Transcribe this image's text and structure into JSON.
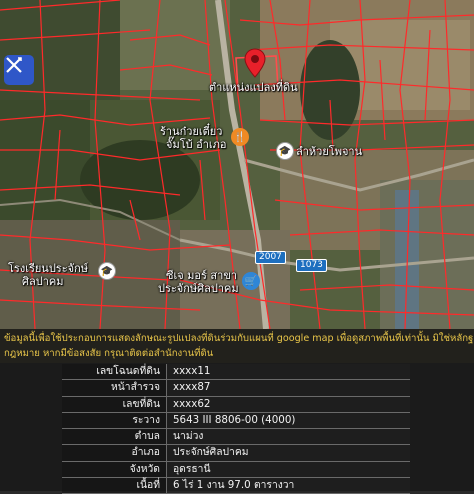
{
  "map": {
    "labels": {
      "parcel_pin": "ตำแหน่งแปลงที่ดิน",
      "noodle_shop_line1": "ร้านก๋วยเตี๋ยว",
      "noodle_shop_line2": "จั๊มโบ้ อำเภอ",
      "lamhuai": "ลำห้วยโพจาน",
      "school_line1": "โรงเรียนประจักษ์",
      "school_line2": "ศิลปาคม",
      "mart_line1": "ซีเจ มอร์ สาขา",
      "mart_line2": "ประจักษ์ศิลปาคม",
      "route_1": "2007",
      "route_2": "1073"
    },
    "icons": {
      "draw_tool": "ruler-pencil-icon",
      "pin": "location-pin-icon",
      "restaurant": "fork-knife-icon",
      "school": "graduation-cap-icon",
      "shop": "shopping-cart-icon"
    },
    "colors": {
      "parcel_lines": "#ff2a2a",
      "pin": "#e8202a",
      "restaurant": "#f08a24",
      "shop": "#2f86d6",
      "draw_button": "#2f57c8"
    }
  },
  "info": {
    "notice_line1": "ข้อมูลนี้เพื่อใช้ประกอบการแสดงลักษณะรูปแปลงที่ดินร่วมกับแผนที่ google map เพื่อดูสภาพพื้นที่เท่านั้น มิใช่หลักฐานที่ใช้ในทาง",
    "notice_line2": "กฎหมาย หากมีข้อสงสัย กรุณาติดต่อสำนักงานที่ดิน",
    "rows": [
      {
        "key": "เลขโฉนดที่ดิน",
        "value": "xxxx11"
      },
      {
        "key": "หน้าสำรวจ",
        "value": "xxxx87"
      },
      {
        "key": "เลขที่ดิน",
        "value": "xxxx62"
      },
      {
        "key": "ระวาง",
        "value": "5643 III 8806-00 (4000)"
      },
      {
        "key": "ตำบล",
        "value": "นาม่วง"
      },
      {
        "key": "อำเภอ",
        "value": "ประจักษ์ศิลปาคม"
      },
      {
        "key": "จังหวัด",
        "value": "อุดรธานี"
      },
      {
        "key": "เนื้อที่",
        "value": "6 ไร่ 1 งาน 97.0 ตารางวา"
      }
    ]
  }
}
